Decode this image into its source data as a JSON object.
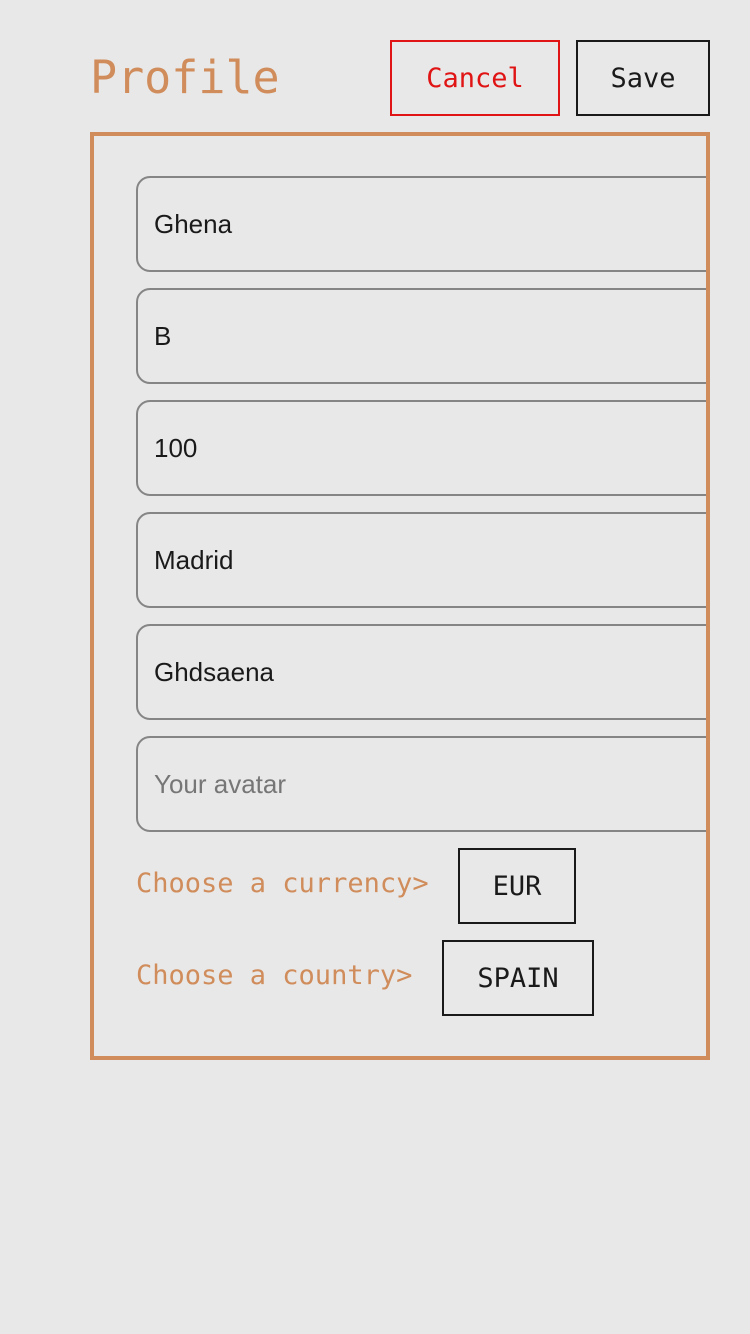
{
  "header": {
    "title": "Profile",
    "cancel_label": "Cancel",
    "save_label": "Save"
  },
  "form": {
    "fields": [
      {
        "value": "Ghena",
        "placeholder": ""
      },
      {
        "value": "B",
        "placeholder": ""
      },
      {
        "value": "100",
        "placeholder": ""
      },
      {
        "value": "Madrid",
        "placeholder": ""
      },
      {
        "value": "Ghdsaena",
        "placeholder": ""
      },
      {
        "value": "",
        "placeholder": "Your avatar"
      }
    ],
    "currency": {
      "label": "Choose a currency>",
      "value": "EUR"
    },
    "country": {
      "label": "Choose a country>",
      "value": "SPAIN"
    }
  },
  "colors": {
    "accent": "#d08c5a",
    "cancel": "#e01414",
    "background": "#e8e8e8"
  }
}
